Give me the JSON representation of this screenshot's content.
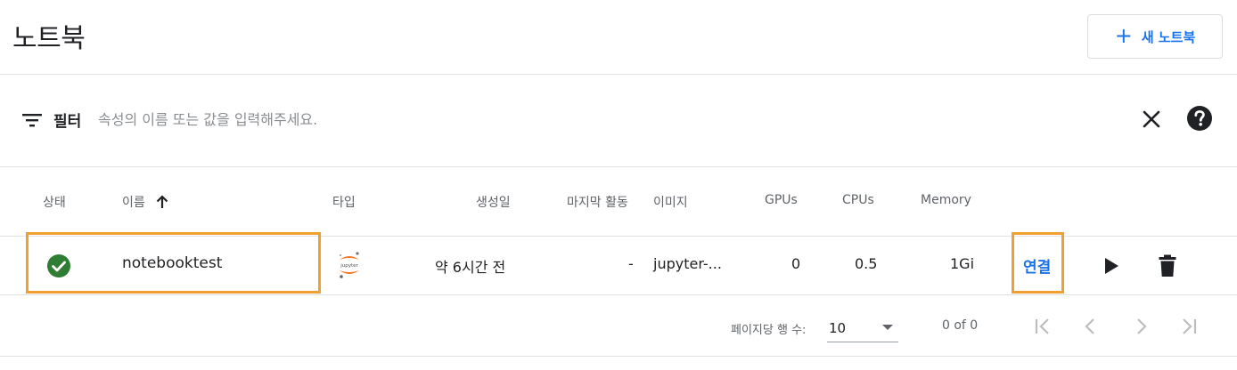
{
  "header": {
    "title": "노트북",
    "new_button_label": "새 노트북"
  },
  "filter": {
    "label": "필터",
    "placeholder": "속성의 이름 또는 값을 입력해주세요."
  },
  "table": {
    "columns": {
      "status": "상태",
      "name": "이름",
      "type": "타입",
      "created": "생성일",
      "last_activity": "마지막 활동",
      "image": "이미지",
      "gpus": "GPUs",
      "cpus": "CPUs",
      "memory": "Memory"
    },
    "rows": [
      {
        "status": "ready",
        "name": "notebooktest",
        "type": "jupyter-logo-icon",
        "created": "약 6시간 전",
        "last_activity": "-",
        "image": "jupyter-...",
        "gpus": "0",
        "cpus": "0.5",
        "memory": "1Gi",
        "connect_label": "연결"
      }
    ]
  },
  "paginator": {
    "rows_per_page_label": "페이지당 행 수:",
    "rows_per_page_value": "10",
    "range_label": "0 of 0"
  },
  "colors": {
    "accent": "#1a73e8",
    "status_ready": "#2e7d32",
    "highlight": "#f0a030",
    "jupyter_orange": "#f37726"
  }
}
